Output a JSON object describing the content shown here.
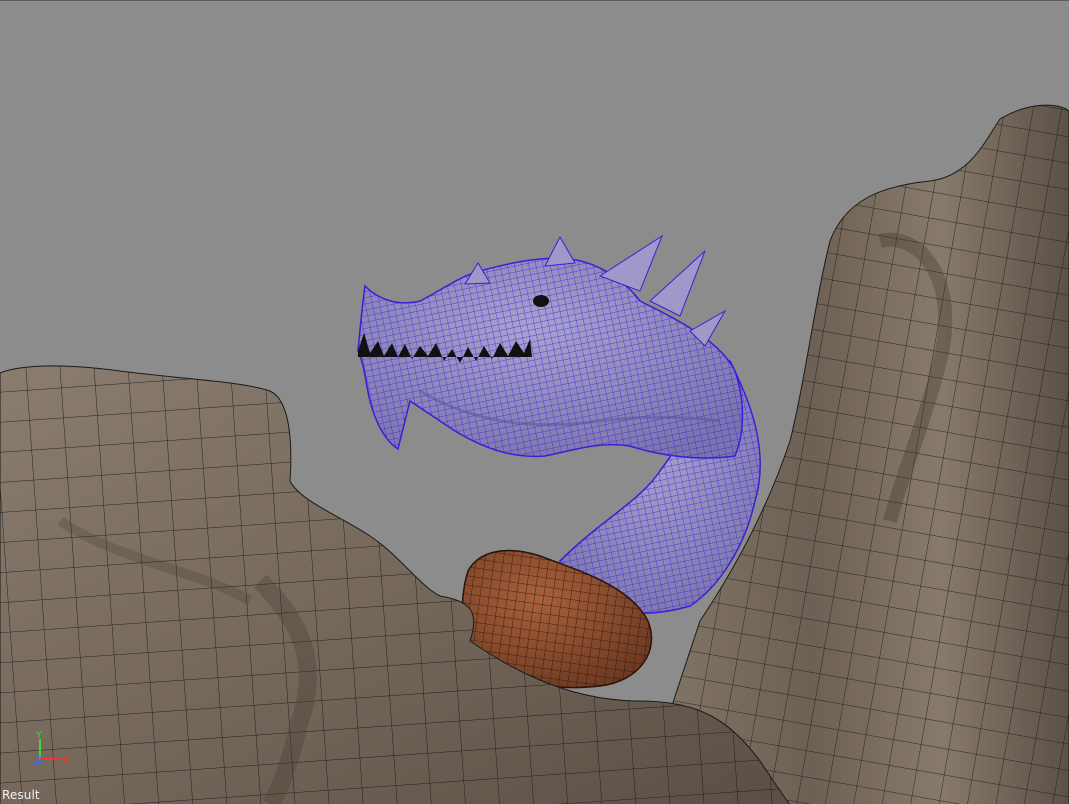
{
  "viewport": {
    "camera_label": "Result",
    "background_color": "#8c8c8c",
    "objects": [
      {
        "name": "rock-terrain",
        "color": "#7b6d60",
        "wireframe_color": "#1a1a1a",
        "selected": false
      },
      {
        "name": "dragon-head",
        "color": "#8c85b8",
        "wireframe_color": "#3b1fd6",
        "selected": true
      },
      {
        "name": "boulder",
        "color": "#8a4a2a",
        "wireframe_color": "#2a1208",
        "selected": false
      },
      {
        "name": "dragon-teeth",
        "color": "#111111",
        "selected": false
      }
    ]
  },
  "axis_gizmo": {
    "x_label": "X",
    "y_label": "Y",
    "z_label": "Z",
    "x_color": "#ff3030",
    "y_color": "#30e030",
    "z_color": "#3070ff"
  }
}
